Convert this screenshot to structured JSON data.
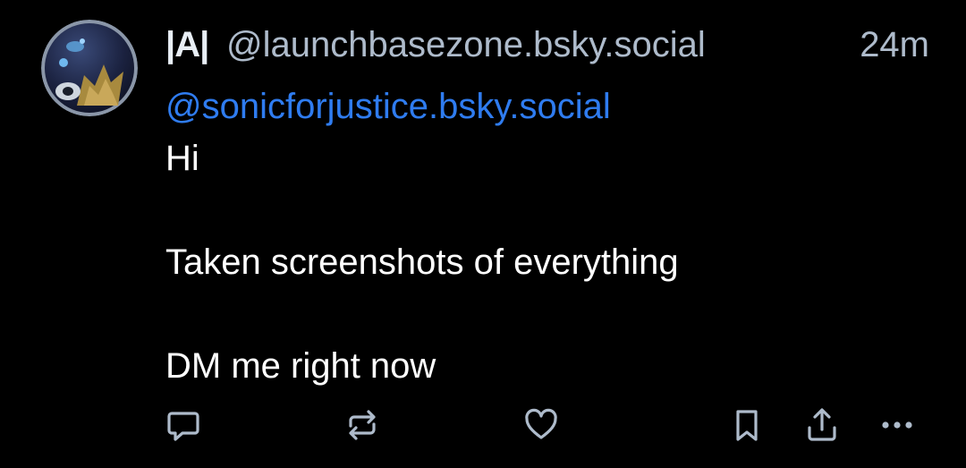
{
  "post": {
    "display_name_glyph": "|A|",
    "handle": "@launchbasezone.bsky.social",
    "timestamp": "24m",
    "mention": "@sonicforjustice.bsky.social",
    "lines": [
      "Hi",
      "",
      "Taken screenshots of everything",
      "",
      "DM me right now"
    ]
  },
  "actions": {
    "reply_icon": "speech-bubble-icon",
    "repost_icon": "repost-arrows-icon",
    "like_icon": "heart-icon",
    "bookmark_icon": "bookmark-icon",
    "share_icon": "share-upload-icon",
    "more_icon": "more-dots-icon"
  },
  "colors": {
    "background": "#000000",
    "text": "#ffffff",
    "muted": "#aebbcb",
    "mention": "#2f7cf0",
    "icon": "#aebbcb"
  }
}
